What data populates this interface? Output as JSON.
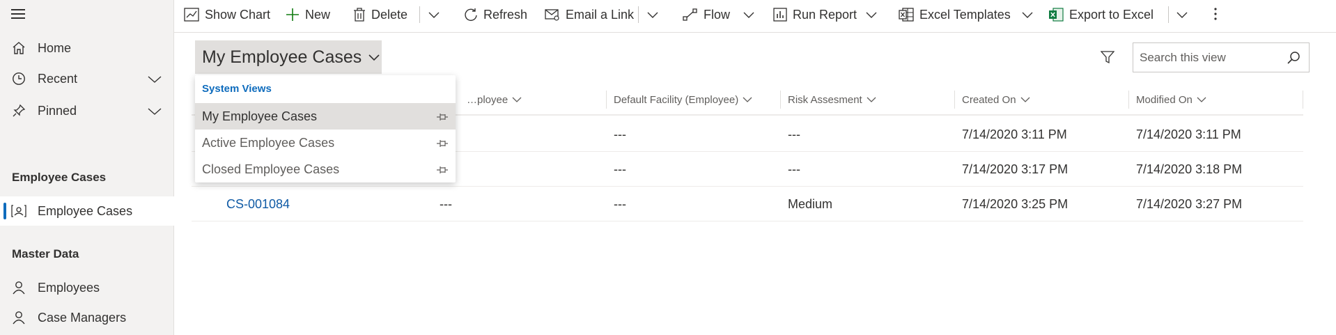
{
  "sidebar": {
    "nav": [
      {
        "label": "Home",
        "icon": "home-icon"
      },
      {
        "label": "Recent",
        "icon": "clock-icon"
      },
      {
        "label": "Pinned",
        "icon": "pin-icon"
      }
    ],
    "section1_title": "Employee Cases",
    "employee_cases_label": "Employee Cases",
    "section2_title": "Master Data",
    "employees_label": "Employees",
    "case_managers_label": "Case Managers",
    "accent_color": "#0f6cbd"
  },
  "toolbar": {
    "show_chart": "Show Chart",
    "new": "New",
    "delete": "Delete",
    "refresh": "Refresh",
    "email_link": "Email a Link",
    "flow": "Flow",
    "run_report": "Run Report",
    "excel_templates": "Excel Templates",
    "export_excel": "Export to Excel"
  },
  "view": {
    "title": "My Employee Cases",
    "search_placeholder": "Search this view"
  },
  "dropdown": {
    "header": "System Views",
    "items": [
      "My Employee Cases",
      "Active Employee Cases",
      "Closed Employee Cases"
    ],
    "selected": "My Employee Cases"
  },
  "grid": {
    "columns": [
      "…ployee",
      "Default Facility (Employee)",
      "Risk Assesment",
      "Created On",
      "Modified On"
    ],
    "rows": [
      {
        "case": "",
        "employee": "",
        "facility": "---",
        "risk": "---",
        "created": "7/14/2020 3:11 PM",
        "modified": "7/14/2020 3:11 PM"
      },
      {
        "case": "",
        "employee": "",
        "facility": "---",
        "risk": "---",
        "created": "7/14/2020 3:17 PM",
        "modified": "7/14/2020 3:18 PM"
      },
      {
        "case": "CS-001084",
        "employee": "---",
        "facility": "---",
        "risk": "Medium",
        "created": "7/14/2020 3:25 PM",
        "modified": "7/14/2020 3:27 PM"
      }
    ]
  }
}
